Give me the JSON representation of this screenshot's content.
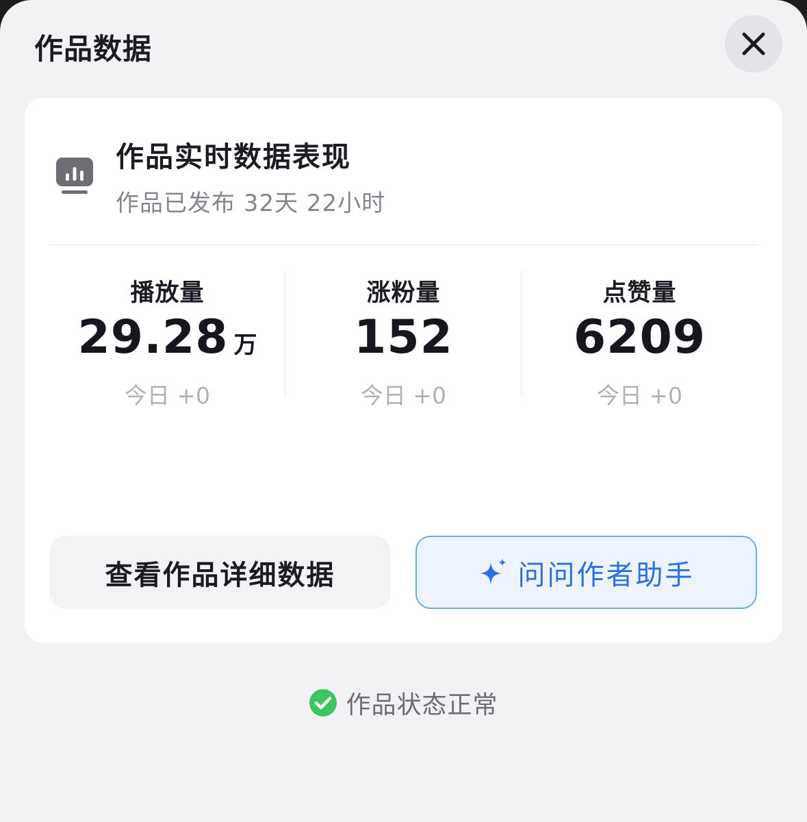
{
  "sheet": {
    "title": "作品数据",
    "close_icon": "close-icon"
  },
  "card": {
    "icon": "bar-chart-monitor-icon",
    "title": "作品实时数据表现",
    "subtitle": "作品已发布 32天 22小时",
    "stats": [
      {
        "label": "播放量",
        "value": "29.28",
        "unit": "万",
        "today": "今日 +0"
      },
      {
        "label": "涨粉量",
        "value": "152",
        "unit": "",
        "today": "今日 +0"
      },
      {
        "label": "点赞量",
        "value": "6209",
        "unit": "",
        "today": "今日 +0"
      }
    ],
    "buttons": {
      "detail_label": "查看作品详细数据",
      "ask_label": "问问作者助手",
      "ask_icon": "sparkle-icon"
    }
  },
  "status": {
    "icon": "check-circle-icon",
    "text": "作品状态正常"
  },
  "colors": {
    "sheet_bg": "#f2f2f5",
    "card_bg": "#ffffff",
    "accent_blue": "#2c6fe0",
    "status_green": "#3dc660"
  }
}
